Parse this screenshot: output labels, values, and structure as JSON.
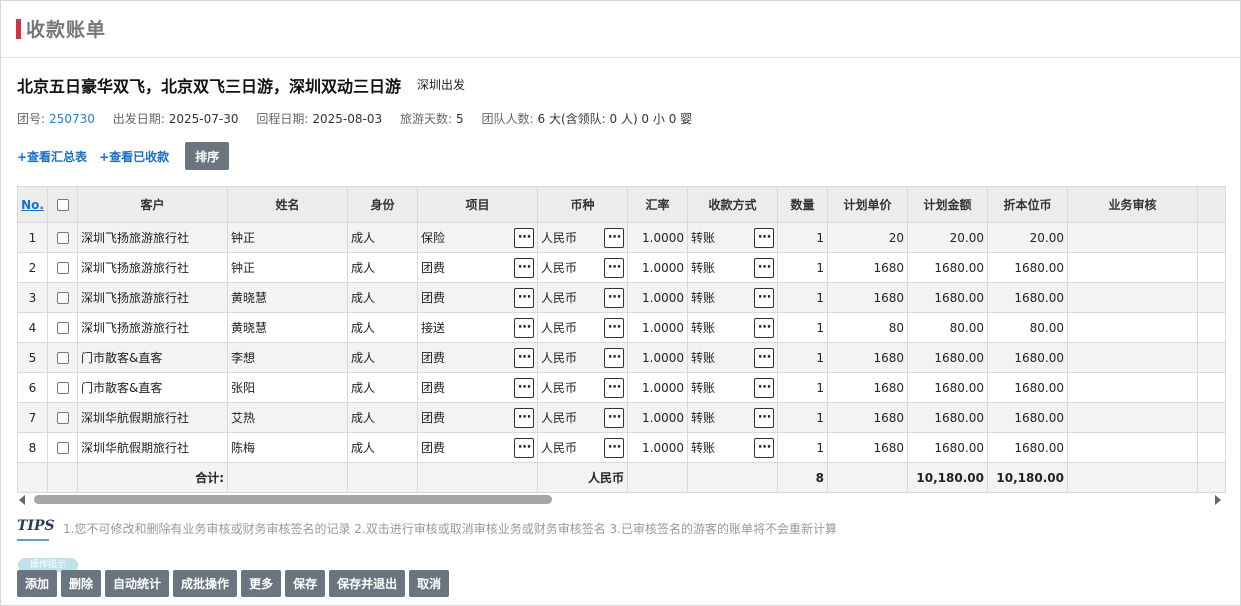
{
  "page_title": "收款账单",
  "tour": {
    "name": "北京五日豪华双飞，北京双飞三日游，深圳双动三日游",
    "depart": "深圳出发"
  },
  "meta": {
    "group_no_label": "团号:",
    "group_no": "250730",
    "depart_date_label": "出发日期:",
    "depart_date": "2025-07-30",
    "return_date_label": "回程日期:",
    "return_date": "2025-08-03",
    "days_label": "旅游天数:",
    "days": "5",
    "people_label": "团队人数:",
    "people": "6 大(含领队: 0 人) 0 小 0 婴"
  },
  "links": {
    "summary": "+查看汇总表",
    "received": "+查看已收款",
    "sort": "排序"
  },
  "columns": [
    "No.",
    "",
    "客户",
    "姓名",
    "身份",
    "项目",
    "币种",
    "汇率",
    "收款方式",
    "数量",
    "计划单价",
    "计划金额",
    "折本位币",
    "业务审核",
    ""
  ],
  "rows": [
    {
      "no": "1",
      "customer": "深圳飞扬旅游旅行社",
      "name": "钟正",
      "identity": "成人",
      "item": "保险",
      "currency": "人民币",
      "rate": "1.0000",
      "pay": "转账",
      "qty": "1",
      "price": "20",
      "amount": "20.00",
      "base": "20.00"
    },
    {
      "no": "2",
      "customer": "深圳飞扬旅游旅行社",
      "name": "钟正",
      "identity": "成人",
      "item": "团费",
      "currency": "人民币",
      "rate": "1.0000",
      "pay": "转账",
      "qty": "1",
      "price": "1680",
      "amount": "1680.00",
      "base": "1680.00"
    },
    {
      "no": "3",
      "customer": "深圳飞扬旅游旅行社",
      "name": "黄晓慧",
      "identity": "成人",
      "item": "团费",
      "currency": "人民币",
      "rate": "1.0000",
      "pay": "转账",
      "qty": "1",
      "price": "1680",
      "amount": "1680.00",
      "base": "1680.00"
    },
    {
      "no": "4",
      "customer": "深圳飞扬旅游旅行社",
      "name": "黄晓慧",
      "identity": "成人",
      "item": "接送",
      "currency": "人民币",
      "rate": "1.0000",
      "pay": "转账",
      "qty": "1",
      "price": "80",
      "amount": "80.00",
      "base": "80.00"
    },
    {
      "no": "5",
      "customer": "门市散客&直客",
      "name": "李想",
      "identity": "成人",
      "item": "团费",
      "currency": "人民币",
      "rate": "1.0000",
      "pay": "转账",
      "qty": "1",
      "price": "1680",
      "amount": "1680.00",
      "base": "1680.00"
    },
    {
      "no": "6",
      "customer": "门市散客&直客",
      "name": "张阳",
      "identity": "成人",
      "item": "团费",
      "currency": "人民币",
      "rate": "1.0000",
      "pay": "转账",
      "qty": "1",
      "price": "1680",
      "amount": "1680.00",
      "base": "1680.00"
    },
    {
      "no": "7",
      "customer": "深圳华航假期旅行社",
      "name": "艾热",
      "identity": "成人",
      "item": "团费",
      "currency": "人民币",
      "rate": "1.0000",
      "pay": "转账",
      "qty": "1",
      "price": "1680",
      "amount": "1680.00",
      "base": "1680.00"
    },
    {
      "no": "8",
      "customer": "深圳华航假期旅行社",
      "name": "陈梅",
      "identity": "成人",
      "item": "团费",
      "currency": "人民币",
      "rate": "1.0000",
      "pay": "转账",
      "qty": "1",
      "price": "1680",
      "amount": "1680.00",
      "base": "1680.00"
    }
  ],
  "total": {
    "label": "合计:",
    "currency": "人民币",
    "qty": "8",
    "amount": "10,180.00",
    "base": "10,180.00"
  },
  "tips": {
    "icon": "TIPS",
    "text": "1.您不可修改和删除有业务审核或财务审核签名的记录  2.双击进行审核或取消审核业务或财务审核签名  3.已审核签名的游客的账单将不会重新计算"
  },
  "toolbar": {
    "bubble": "操作提示",
    "buttons": [
      "添加",
      "删除",
      "自动统计",
      "成批操作",
      "更多",
      "保存",
      "保存并退出",
      "取消"
    ]
  },
  "colors": {
    "accent": "#d9304a",
    "button": "#6b7580",
    "link": "#1a6fc7"
  },
  "icons": {
    "more": "ellipsis-icon",
    "tips": "tips-icon"
  }
}
